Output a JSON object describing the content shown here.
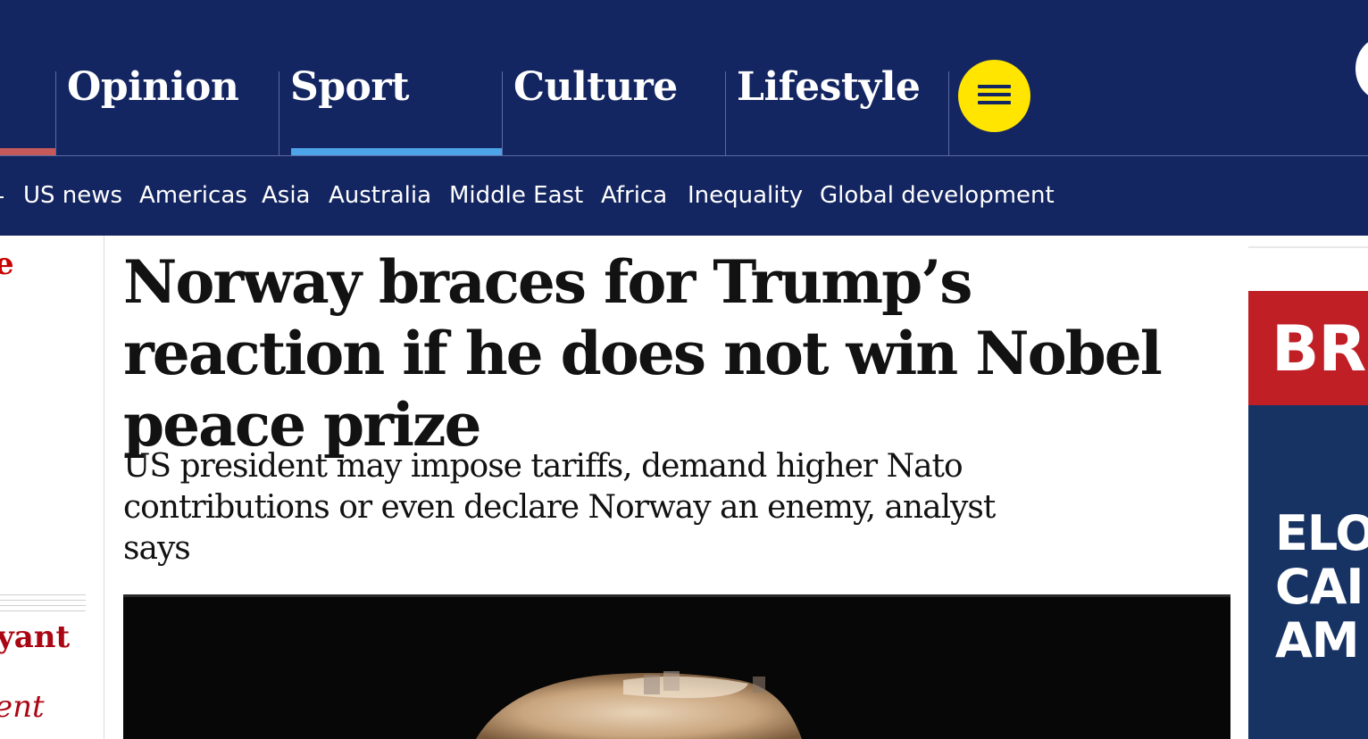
{
  "nav": {
    "pillars": [
      {
        "label": "Opinion"
      },
      {
        "label": "Sport"
      },
      {
        "label": "Culture"
      },
      {
        "label": "Lifestyle"
      }
    ],
    "active_pillar": "Sport",
    "menu_icon": "hamburger-menu-icon",
    "subnav": [
      "US news",
      "Americas",
      "Asia",
      "Australia",
      "Middle East",
      "Africa",
      "Inequality",
      "Global development"
    ]
  },
  "article": {
    "headline": "Norway braces for Trump’s reaction if he does not win Nobel peace prize",
    "standfirst": "US president may impose tariffs, demand higher Nato contributions or even declare Norway an enemy, analyst says"
  },
  "left_rail": {
    "fragment_top": "e",
    "fragment_mid": "yant",
    "fragment_bottom": "ent"
  },
  "ad": {
    "top_text": "BR",
    "lines": [
      "ELO",
      "CAI",
      "AM"
    ]
  },
  "colors": {
    "nav_background": "#142661",
    "menu_button": "#ffe500",
    "sport_accent": "#4ea4e8",
    "news_accent": "#c65a5a",
    "ad_red": "#c01f26",
    "ad_blue": "#173364"
  }
}
